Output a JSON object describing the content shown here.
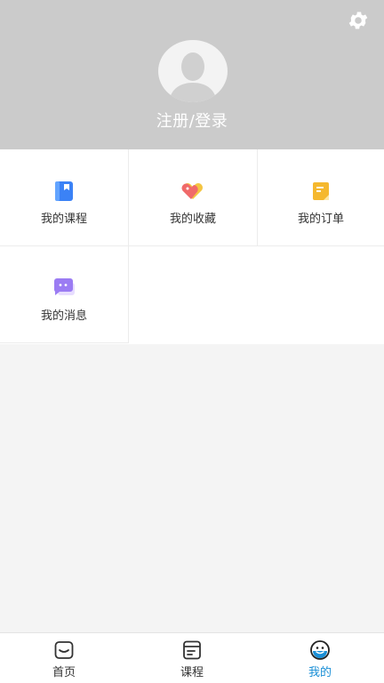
{
  "header": {
    "login_label": "注册/登录",
    "background_color": "#cbcbcb",
    "settings_icon": "gear-icon",
    "avatar_icon": "default-avatar-icon"
  },
  "menu": {
    "items": [
      {
        "label": "我的课程",
        "icon": "book-icon",
        "color": "#3b82f6"
      },
      {
        "label": "我的收藏",
        "icon": "heart-tag-icon",
        "color": "#f06a6a"
      },
      {
        "label": "我的订单",
        "icon": "order-note-icon",
        "color": "#f5b82e"
      },
      {
        "label": "我的消息",
        "icon": "chat-bubble-icon",
        "color": "#9b7cf3"
      }
    ]
  },
  "tabbar": {
    "tabs": [
      {
        "label": "首页",
        "icon": "home-icon",
        "active": false
      },
      {
        "label": "课程",
        "icon": "course-icon",
        "active": false
      },
      {
        "label": "我的",
        "icon": "profile-face-icon",
        "active": true
      }
    ],
    "active_color": "#1a8fd6"
  }
}
